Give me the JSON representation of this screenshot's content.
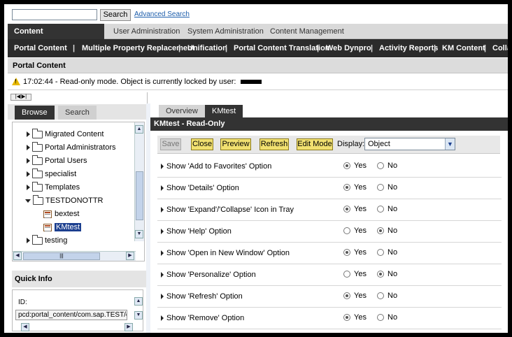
{
  "topbar": {
    "search_value": "",
    "search_label": "Search",
    "advanced_search": "Advanced Search"
  },
  "nav1": [
    "Content Administration",
    "User Administration",
    "System Administration",
    "Content Management"
  ],
  "nav2": [
    "Portal Content",
    "Multiple Property Replacement",
    "Unification",
    "Portal Content Translation",
    "Web Dynpro",
    "Activity Reports",
    "KM Content",
    "Colla"
  ],
  "page_header": "Portal Content",
  "message": "17:02:44 - Read-only mode. Object is currently locked by user:",
  "left": {
    "collapse": "|◀|▶|",
    "tabs": [
      "Browse",
      "Search"
    ],
    "tree": [
      {
        "label": "Migrated Content",
        "type": "folder",
        "expanded": false
      },
      {
        "label": "Portal Administrators",
        "type": "folder",
        "expanded": false
      },
      {
        "label": "Portal Users",
        "type": "folder",
        "expanded": false
      },
      {
        "label": "specialist",
        "type": "folder",
        "expanded": false
      },
      {
        "label": "Templates",
        "type": "folder",
        "expanded": false
      },
      {
        "label": "TESTDONOTTR",
        "type": "folder",
        "expanded": true
      },
      {
        "label": "bextest",
        "type": "doc"
      },
      {
        "label": "KMtest",
        "type": "doc",
        "selected": true
      },
      {
        "label": "testing",
        "type": "folder",
        "expanded": false
      }
    ],
    "quick_info": {
      "title": "Quick Info",
      "id_label": "ID:",
      "id_value": "pcd:portal_content/com.sap.TEST/com"
    }
  },
  "right": {
    "tabs": [
      "Overview",
      "KMtest"
    ],
    "title": "KMtest - Read-Only",
    "toolbar": {
      "save": "Save",
      "close": "Close",
      "preview": "Preview",
      "refresh": "Refresh",
      "edit_mode": "Edit Mode",
      "display_label": "Display:",
      "display_value": "Object"
    },
    "options": [
      {
        "label": "Show 'Add to Favorites' Option",
        "value": "Yes"
      },
      {
        "label": "Show 'Details' Option",
        "value": "Yes"
      },
      {
        "label": "Show 'Expand'/'Collapse' Icon in Tray",
        "value": "Yes"
      },
      {
        "label": "Show 'Help' Option",
        "value": "No"
      },
      {
        "label": "Show 'Open in New Window' Option",
        "value": "Yes"
      },
      {
        "label": "Show 'Personalize' Option",
        "value": "No"
      },
      {
        "label": "Show 'Refresh' Option",
        "value": "Yes"
      },
      {
        "label": "Show 'Remove' Option",
        "value": "Yes"
      }
    ],
    "yes_label": "Yes",
    "no_label": "No"
  }
}
